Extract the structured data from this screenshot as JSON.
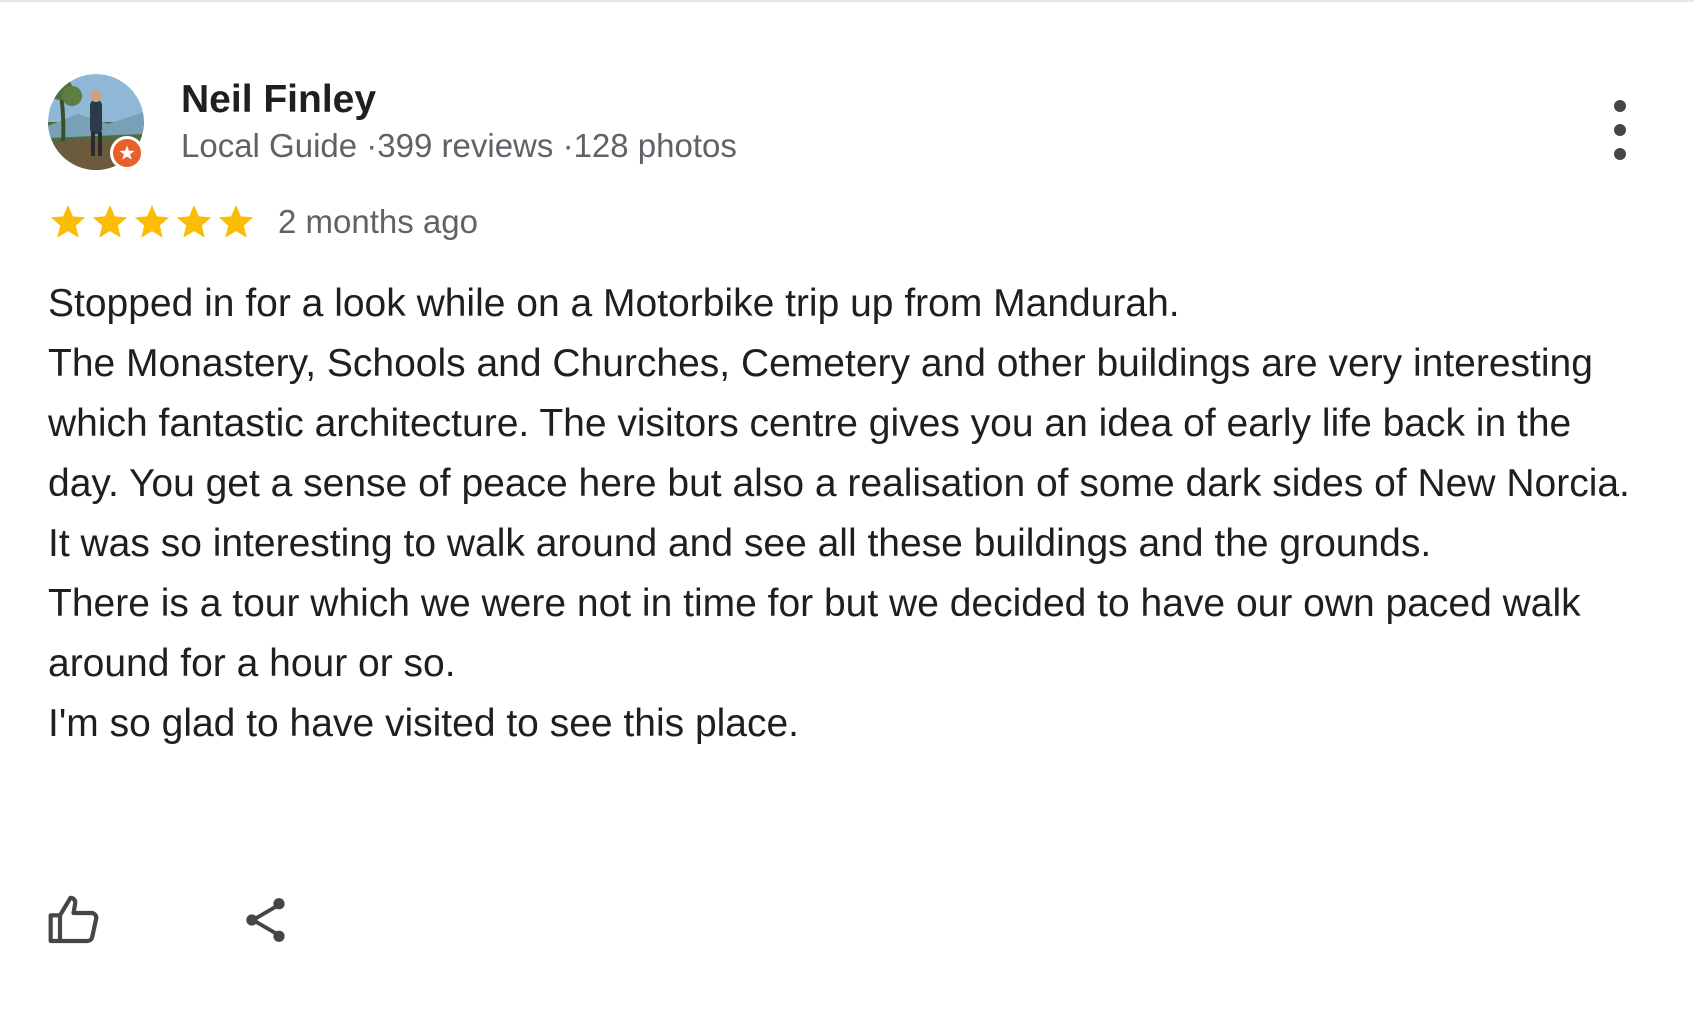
{
  "review": {
    "author": {
      "name": "Neil Finley",
      "badge": "Local Guide",
      "reviews": "399 reviews",
      "photos": "128 photos",
      "separator": "·",
      "avatar_icon": "profile-photo",
      "badge_icon": "local-guide-star-badge"
    },
    "rating": {
      "stars": 5,
      "max": 5,
      "star_color": "#fbbc04",
      "date": "2 months ago"
    },
    "text": [
      "Stopped in for a look while on a Motorbike trip up from Mandurah.",
      "The Monastery, Schools and Churches, Cemetery and other buildings are very interesting which fantastic architecture. The visitors centre gives you an idea of early life back in the day. You get a sense of peace here but also a realisation of some dark sides of New Norcia.",
      "It was so interesting to walk around and see all these buildings and the grounds.",
      "There is a tour which we were not in time for but we decided to have our own paced walk around for a hour or so.",
      "I'm so glad to have visited to see this place."
    ],
    "actions": {
      "like_icon": "thumbs-up",
      "share_icon": "share",
      "more_icon": "more-vertical"
    }
  },
  "colors": {
    "text": "#1f1f1f",
    "secondary_text": "#5f6368",
    "star": "#fbbc04",
    "guide_badge": "#e8602c",
    "icon": "#444746"
  }
}
